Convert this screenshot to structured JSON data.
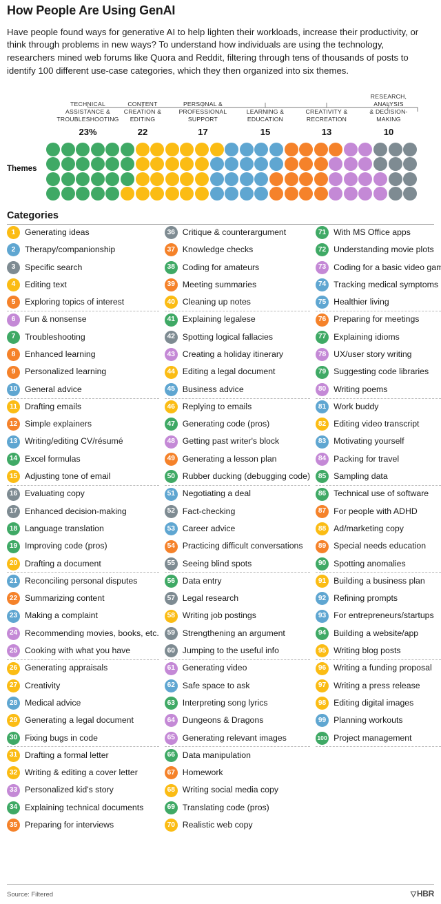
{
  "header": {
    "title": "How People Are Using GenAI",
    "dek": "Have people found ways for generative AI to help lighten their workloads, increase their productivity, or think through problems in new ways? To understand how individuals are using the technology, researchers mined web forums like Quora and Reddit, filtering through tens of thousands of posts to identify 100 different use-case categories, which they then organized into six themes."
  },
  "themes_axis_label": "Themes",
  "categories_title": "Categories",
  "colors": {
    "green": "#3fa965",
    "yellow": "#fbbc14",
    "blue": "#5fa6d1",
    "orange": "#f5822a",
    "purple": "#c489d6",
    "gray": "#7e8b92"
  },
  "chart_data": {
    "type": "waffle",
    "title": "How People Are Using GenAI",
    "unit": "percent of 100 use-case categories",
    "total_dots": 100,
    "rows": 4,
    "columns": 25,
    "categories": [
      "TECHNICAL ASSISTANCE & TROUBLESHOOTING",
      "CONTENT CREATION & EDITING",
      "PERSONAL & PROFESSIONAL SUPPORT",
      "LEARNING & EDUCATION",
      "CREATIVITY & RECREATION",
      "RESEARCH, ANALYSIS & DECISION-MAKING"
    ],
    "values": [
      23,
      22,
      17,
      15,
      13,
      10
    ],
    "value_labels": [
      "23%",
      "22",
      "17",
      "15",
      "13",
      "10"
    ],
    "series_colors": [
      "#3fa965",
      "#fbbc14",
      "#5fa6d1",
      "#f5822a",
      "#c489d6",
      "#7e8b92"
    ]
  },
  "themes": [
    {
      "label": "TECHNICAL\nASSISTANCE &\nTROUBLESHOOTING",
      "lines": [
        "TECHNICAL",
        "ASSISTANCE &",
        "TROUBLESHOOTING"
      ],
      "value": "23%",
      "color": "#3fa965"
    },
    {
      "label": "CONTENT\nCREATION &\nEDITING",
      "lines": [
        "CONTENT",
        "CREATION &",
        "EDITING"
      ],
      "value": "22",
      "color": "#fbbc14"
    },
    {
      "label": "PERSONAL &\nPROFESSIONAL\nSUPPORT",
      "lines": [
        "PERSONAL &",
        "PROFESSIONAL",
        "SUPPORT"
      ],
      "value": "17",
      "color": "#5fa6d1"
    },
    {
      "label": "LEARNING &\nEDUCATION",
      "lines": [
        "LEARNING &",
        "EDUCATION"
      ],
      "value": "15",
      "color": "#f5822a"
    },
    {
      "label": "CREATIVITY &\nRECREATION",
      "lines": [
        "CREATIVITY &",
        "RECREATION"
      ],
      "value": "13",
      "color": "#c489d6"
    },
    {
      "label": "RESEARCH,\nANALYSIS\n& DECISION-\nMAKING",
      "lines": [
        "RESEARCH,",
        "ANALYSIS",
        "& DECISION-",
        "MAKING"
      ],
      "value": "10",
      "color": "#7e8b92"
    }
  ],
  "dot_sequence": [
    "green",
    "green",
    "green",
    "green",
    "green",
    "green",
    "yellow",
    "yellow",
    "yellow",
    "yellow",
    "yellow",
    "yellow",
    "blue",
    "blue",
    "blue",
    "blue",
    "orange",
    "orange",
    "orange",
    "orange",
    "purple",
    "purple",
    "gray",
    "gray",
    "gray",
    "green",
    "green",
    "green",
    "green",
    "green",
    "green",
    "yellow",
    "yellow",
    "yellow",
    "yellow",
    "yellow",
    "blue",
    "blue",
    "blue",
    "blue",
    "blue",
    "orange",
    "orange",
    "orange",
    "purple",
    "purple",
    "purple",
    "gray",
    "gray",
    "gray",
    "green",
    "green",
    "green",
    "green",
    "green",
    "green",
    "yellow",
    "yellow",
    "yellow",
    "yellow",
    "yellow",
    "blue",
    "blue",
    "blue",
    "blue",
    "orange",
    "orange",
    "orange",
    "orange",
    "purple",
    "purple",
    "purple",
    "purple",
    "gray",
    "gray",
    "green",
    "green",
    "green",
    "green",
    "green",
    "yellow",
    "yellow",
    "yellow",
    "yellow",
    "yellow",
    "yellow",
    "blue",
    "blue",
    "blue",
    "blue",
    "orange",
    "orange",
    "orange",
    "orange",
    "purple",
    "purple",
    "purple",
    "purple",
    "gray",
    "gray"
  ],
  "column1": [
    {
      "n": "1",
      "label": "Generating ideas",
      "color": "yellow"
    },
    {
      "n": "2",
      "label": "Therapy/companionship",
      "color": "blue"
    },
    {
      "n": "3",
      "label": "Specific search",
      "color": "gray"
    },
    {
      "n": "4",
      "label": "Editing text",
      "color": "yellow"
    },
    {
      "n": "5",
      "label": "Exploring topics of interest",
      "color": "orange",
      "sep": true
    },
    {
      "n": "6",
      "label": "Fun & nonsense",
      "color": "purple"
    },
    {
      "n": "7",
      "label": "Troubleshooting",
      "color": "green"
    },
    {
      "n": "8",
      "label": "Enhanced learning",
      "color": "orange"
    },
    {
      "n": "9",
      "label": "Personalized learning",
      "color": "orange"
    },
    {
      "n": "10",
      "label": "General advice",
      "color": "blue",
      "sep": true
    },
    {
      "n": "11",
      "label": "Drafting emails",
      "color": "yellow"
    },
    {
      "n": "12",
      "label": "Simple explainers",
      "color": "orange"
    },
    {
      "n": "13",
      "label": "Writing/editing CV/résumé",
      "color": "blue"
    },
    {
      "n": "14",
      "label": "Excel formulas",
      "color": "green"
    },
    {
      "n": "15",
      "label": "Adjusting tone of email",
      "color": "yellow",
      "sep": true
    },
    {
      "n": "16",
      "label": "Evaluating copy",
      "color": "gray"
    },
    {
      "n": "17",
      "label": "Enhanced decision-making",
      "color": "gray"
    },
    {
      "n": "18",
      "label": "Language translation",
      "color": "green"
    },
    {
      "n": "19",
      "label": "Improving code (pros)",
      "color": "green"
    },
    {
      "n": "20",
      "label": "Drafting a document",
      "color": "yellow",
      "sep": true
    },
    {
      "n": "21",
      "label": "Reconciling personal disputes",
      "color": "blue"
    },
    {
      "n": "22",
      "label": "Summarizing content",
      "color": "orange"
    },
    {
      "n": "23",
      "label": "Making a complaint",
      "color": "blue"
    },
    {
      "n": "24",
      "label": "Recommending movies, books, etc.",
      "color": "purple"
    },
    {
      "n": "25",
      "label": "Cooking with what you have",
      "color": "purple",
      "sep": true
    },
    {
      "n": "26",
      "label": "Generating appraisals",
      "color": "yellow"
    },
    {
      "n": "27",
      "label": "Creativity",
      "color": "yellow"
    },
    {
      "n": "28",
      "label": "Medical advice",
      "color": "blue"
    },
    {
      "n": "29",
      "label": "Generating a legal document",
      "color": "yellow"
    },
    {
      "n": "30",
      "label": "Fixing bugs in code",
      "color": "green",
      "sep": true
    },
    {
      "n": "31",
      "label": "Drafting a formal letter",
      "color": "yellow"
    },
    {
      "n": "32",
      "label": "Writing & editing a cover letter",
      "color": "yellow"
    },
    {
      "n": "33",
      "label": "Personalized kid's story",
      "color": "purple"
    },
    {
      "n": "34",
      "label": "Explaining technical documents",
      "color": "green"
    },
    {
      "n": "35",
      "label": "Preparing for interviews",
      "color": "orange"
    }
  ],
  "column2": [
    {
      "n": "36",
      "label": "Critique & counterargument",
      "color": "gray"
    },
    {
      "n": "37",
      "label": "Knowledge checks",
      "color": "orange"
    },
    {
      "n": "38",
      "label": "Coding for amateurs",
      "color": "green"
    },
    {
      "n": "39",
      "label": "Meeting summaries",
      "color": "orange"
    },
    {
      "n": "40",
      "label": "Cleaning up notes",
      "color": "yellow",
      "sep": true
    },
    {
      "n": "41",
      "label": "Explaining legalese",
      "color": "green"
    },
    {
      "n": "42",
      "label": "Spotting logical fallacies",
      "color": "gray"
    },
    {
      "n": "43",
      "label": "Creating a holiday itinerary",
      "color": "purple"
    },
    {
      "n": "44",
      "label": "Editing a legal document",
      "color": "yellow"
    },
    {
      "n": "45",
      "label": "Business advice",
      "color": "blue",
      "sep": true
    },
    {
      "n": "46",
      "label": "Replying to emails",
      "color": "yellow"
    },
    {
      "n": "47",
      "label": "Generating code (pros)",
      "color": "green"
    },
    {
      "n": "48",
      "label": "Getting past writer's block",
      "color": "purple"
    },
    {
      "n": "49",
      "label": "Generating a lesson plan",
      "color": "orange"
    },
    {
      "n": "50",
      "label": "Rubber ducking (debugging code)",
      "color": "green",
      "sep": true
    },
    {
      "n": "51",
      "label": "Negotiating a deal",
      "color": "blue"
    },
    {
      "n": "52",
      "label": "Fact-checking",
      "color": "gray"
    },
    {
      "n": "53",
      "label": "Career advice",
      "color": "blue"
    },
    {
      "n": "54",
      "label": "Practicing difficult conversations",
      "color": "orange"
    },
    {
      "n": "55",
      "label": "Seeing blind spots",
      "color": "gray",
      "sep": true
    },
    {
      "n": "56",
      "label": "Data entry",
      "color": "green"
    },
    {
      "n": "57",
      "label": "Legal research",
      "color": "gray"
    },
    {
      "n": "58",
      "label": "Writing job postings",
      "color": "yellow"
    },
    {
      "n": "59",
      "label": "Strengthening an argument",
      "color": "gray"
    },
    {
      "n": "60",
      "label": "Jumping to the useful info",
      "color": "gray",
      "sep": true
    },
    {
      "n": "61",
      "label": "Generating video",
      "color": "purple"
    },
    {
      "n": "62",
      "label": "Safe space to ask",
      "color": "blue"
    },
    {
      "n": "63",
      "label": "Interpreting song lyrics",
      "color": "green"
    },
    {
      "n": "64",
      "label": "Dungeons & Dragons",
      "color": "purple"
    },
    {
      "n": "65",
      "label": "Generating relevant images",
      "color": "purple",
      "sep": true
    },
    {
      "n": "66",
      "label": "Data manipulation",
      "color": "green"
    },
    {
      "n": "67",
      "label": "Homework",
      "color": "orange"
    },
    {
      "n": "68",
      "label": "Writing social media copy",
      "color": "yellow"
    },
    {
      "n": "69",
      "label": "Translating code (pros)",
      "color": "green"
    },
    {
      "n": "70",
      "label": "Realistic web copy",
      "color": "yellow"
    }
  ],
  "column3": [
    {
      "n": "71",
      "label": "With MS Office apps",
      "color": "green"
    },
    {
      "n": "72",
      "label": "Understanding movie plots",
      "color": "green"
    },
    {
      "n": "73",
      "label": "Coding for a basic video game",
      "color": "purple"
    },
    {
      "n": "74",
      "label": "Tracking medical symptoms",
      "color": "blue"
    },
    {
      "n": "75",
      "label": "Healthier living",
      "color": "blue",
      "sep": true
    },
    {
      "n": "76",
      "label": "Preparing for meetings",
      "color": "orange"
    },
    {
      "n": "77",
      "label": "Explaining idioms",
      "color": "green"
    },
    {
      "n": "78",
      "label": "UX/user story writing",
      "color": "purple"
    },
    {
      "n": "79",
      "label": "Suggesting code libraries",
      "color": "green"
    },
    {
      "n": "80",
      "label": "Writing poems",
      "color": "purple",
      "sep": true
    },
    {
      "n": "81",
      "label": "Work buddy",
      "color": "blue"
    },
    {
      "n": "82",
      "label": "Editing video transcript",
      "color": "yellow"
    },
    {
      "n": "83",
      "label": "Motivating yourself",
      "color": "blue"
    },
    {
      "n": "84",
      "label": "Packing for travel",
      "color": "purple"
    },
    {
      "n": "85",
      "label": "Sampling data",
      "color": "green",
      "sep": true
    },
    {
      "n": "86",
      "label": "Technical use of software",
      "color": "green"
    },
    {
      "n": "87",
      "label": "For people with ADHD",
      "color": "orange"
    },
    {
      "n": "88",
      "label": "Ad/marketing copy",
      "color": "yellow"
    },
    {
      "n": "89",
      "label": "Special needs education",
      "color": "orange"
    },
    {
      "n": "90",
      "label": "Spotting anomalies",
      "color": "green",
      "sep": true
    },
    {
      "n": "91",
      "label": "Building a business plan",
      "color": "yellow"
    },
    {
      "n": "92",
      "label": "Refining prompts",
      "color": "blue"
    },
    {
      "n": "93",
      "label": "For entrepreneurs/startups",
      "color": "blue"
    },
    {
      "n": "94",
      "label": "Building a website/app",
      "color": "green"
    },
    {
      "n": "95",
      "label": "Writing blog posts",
      "color": "yellow",
      "sep": true
    },
    {
      "n": "96",
      "label": "Writing a funding proposal",
      "color": "yellow"
    },
    {
      "n": "97",
      "label": "Writing a press release",
      "color": "yellow"
    },
    {
      "n": "98",
      "label": "Editing digital images",
      "color": "yellow"
    },
    {
      "n": "99",
      "label": "Planning workouts",
      "color": "blue"
    },
    {
      "n": "100",
      "label": "Project management",
      "color": "green",
      "sep": true
    }
  ],
  "footer": {
    "source": "Source: Filtered",
    "brand": "HBR"
  }
}
